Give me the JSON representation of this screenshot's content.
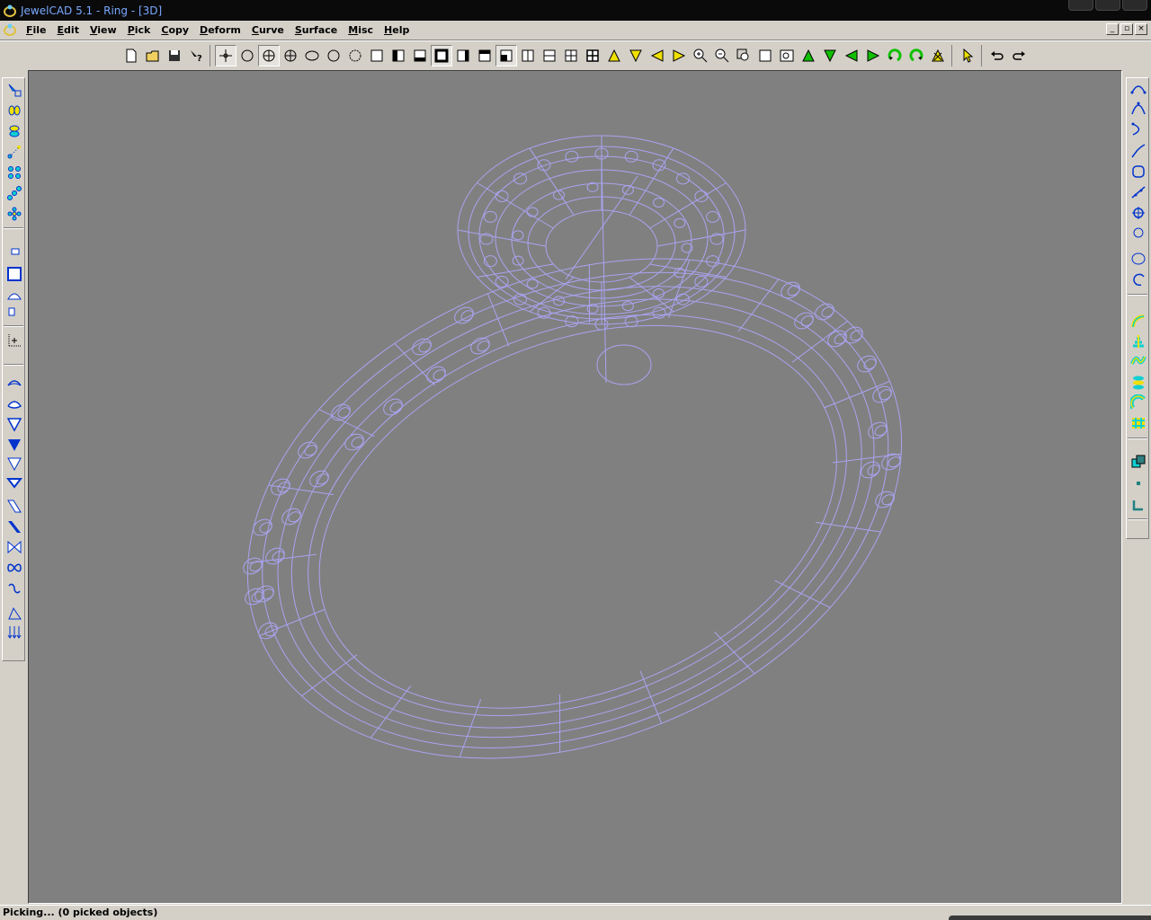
{
  "window": {
    "title": "JewelCAD 5.1 - Ring - [3D]"
  },
  "menu": {
    "items": [
      "File",
      "Edit",
      "View",
      "Pick",
      "Copy",
      "Deform",
      "Curve",
      "Surface",
      "Misc",
      "Help"
    ]
  },
  "status": {
    "text": "Picking... (0 picked objects)"
  },
  "colors": {
    "viewport_bg": "#808080",
    "wireframe": "#a9a3f0",
    "title_bg": "#0a0a0a",
    "title_text": "#7aa9ff"
  },
  "toolbar": {
    "icons": [
      "new-file-icon",
      "open-folder-icon",
      "save-icon",
      "help-pointer-icon",
      "pick-point-icon",
      "circle-view-icon",
      "sphere-view-icon",
      "globe-view-icon",
      "ellipse-icon",
      "circle-icon",
      "dashed-circle-icon",
      "square-view-icon",
      "left-half-view-icon",
      "bottom-view-icon",
      "front-view-icon",
      "right-half-view-icon",
      "top-view-icon",
      "corner-view-icon",
      "two-column-view-icon",
      "two-row-view-icon",
      "four-view-icon",
      "grid-view-icon",
      "rotate-up-icon",
      "rotate-down-icon",
      "rotate-left-icon",
      "rotate-right-icon",
      "zoom-in-icon",
      "zoom-out-icon",
      "zoom-window-icon",
      "zoom-box-icon",
      "zoom-all-icon",
      "move-up-icon",
      "move-down-icon",
      "move-left-icon",
      "move-right-icon",
      "spin-cw-icon",
      "spin-ccw-icon",
      "render-icon",
      "select-arrow-icon",
      "undo-icon",
      "redo-icon"
    ]
  }
}
